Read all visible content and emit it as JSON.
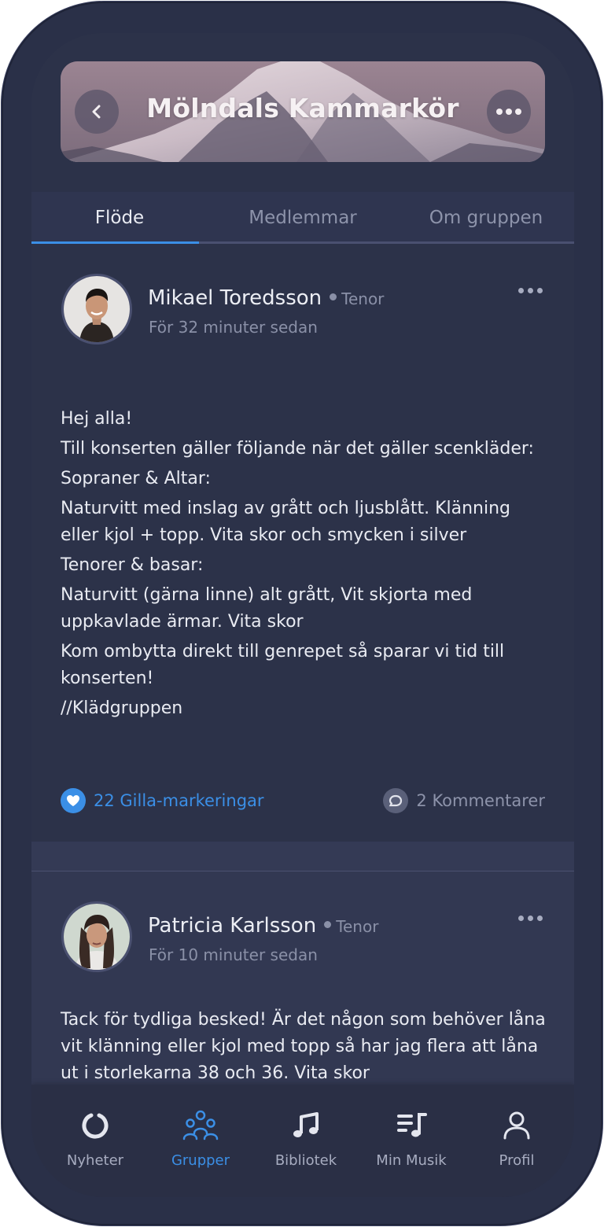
{
  "header": {
    "title": "Mölndals Kammarkör",
    "back_icon": "chevron-left-icon",
    "more_icon": "more-horizontal-icon"
  },
  "tabs": [
    {
      "label": "Flöde",
      "active": true
    },
    {
      "label": "Medlemmar",
      "active": false
    },
    {
      "label": "Om gruppen",
      "active": false
    }
  ],
  "posts": [
    {
      "author": "Mikael Toredsson",
      "role": "Tenor",
      "time": "För 32 minuter sedan",
      "lines": [
        "Hej alla!",
        "Till konserten gäller följande när det gäller scenkläder:",
        "Sopraner & Altar:",
        "Naturvitt med inslag av grått och ljusblått. Klänning eller kjol + topp. Vita skor och smycken i silver",
        "Tenorer & basar:",
        "Naturvitt (gärna linne) alt grått, Vit skjorta med uppkavlade ärmar. Vita skor",
        "Kom ombytta direkt till genrepet så sparar vi tid till konserten!",
        "//Klädgruppen"
      ],
      "likes": "22 Gilla-markeringar",
      "comments": "2 Kommentarer"
    },
    {
      "author": "Patricia Karlsson",
      "role": "Tenor",
      "time": "För 10 minuter sedan",
      "lines": [
        "Tack för tydliga besked! Är det någon som behöver låna vit klänning eller kjol med topp så har jag flera att låna ut i storlekarna 38 och 36. Vita skor"
      ]
    }
  ],
  "nav": [
    {
      "label": "Nyheter",
      "icon": "news-ring-icon",
      "active": false
    },
    {
      "label": "Grupper",
      "icon": "groups-icon",
      "active": true
    },
    {
      "label": "Bibliotek",
      "icon": "music-note-icon",
      "active": false
    },
    {
      "label": "Min Musik",
      "icon": "playlist-icon",
      "active": false
    },
    {
      "label": "Profil",
      "icon": "profile-icon",
      "active": false
    }
  ],
  "colors": {
    "accent": "#3b8fe6",
    "background": "#2c3249",
    "text": "#e9ebf2",
    "muted": "#8a90a7"
  }
}
